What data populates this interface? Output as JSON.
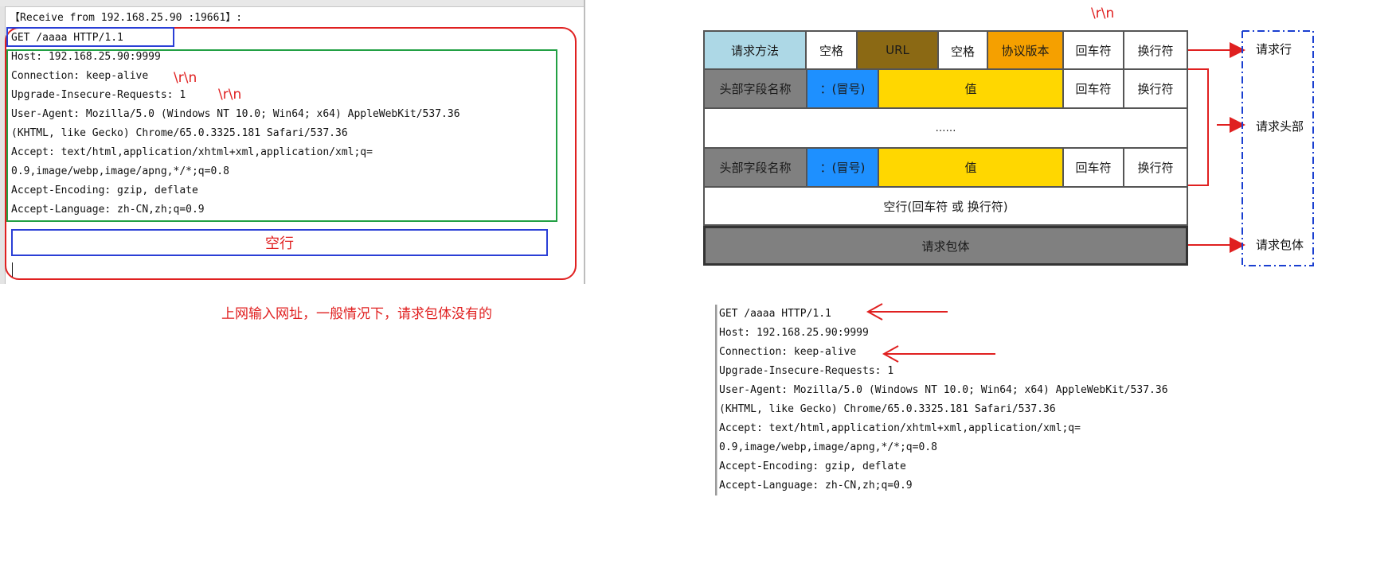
{
  "left_panel": {
    "receive_line": "【Receive from 192.168.25.90 :19661】:",
    "lines": [
      "GET /aaaa HTTP/1.1",
      "Host: 192.168.25.90:9999",
      "Connection: keep-alive",
      "Upgrade-Insecure-Requests: 1",
      "User-Agent: Mozilla/5.0 (Windows NT 10.0; Win64; x64) AppleWebKit/537.36",
      "(KHTML, like Gecko) Chrome/65.0.3325.181 Safari/537.36",
      "Accept: text/html,application/xhtml+xml,application/xml;q=",
      "0.9,image/webp,image/apng,*/*;q=0.8",
      "Accept-Encoding: gzip, deflate",
      "Accept-Language: zh-CN,zh;q=0.9"
    ],
    "crlf_1": "\\r\\n",
    "crlf_2": "\\r\\n",
    "empty_line_label": "空行"
  },
  "caption": "上网输入网址，一般情况下，请求包体没有的",
  "diagram": {
    "top_crlf": "\\r\\n",
    "request_line": [
      "请求方法",
      "空格",
      "URL",
      "空格",
      "协议版本",
      "回车符",
      "换行符"
    ],
    "header_row": [
      "头部字段名称",
      "：(冒号)",
      "值",
      "回车符",
      "换行符"
    ],
    "ellipsis": "……",
    "empty_line": "空行(回车符 或 换行符)",
    "body": "请求包体",
    "side_labels": {
      "request_line": "请求行",
      "request_headers": "请求头部",
      "request_body": "请求包体"
    },
    "colors": {
      "method": "#add8e6",
      "url": "#8b6914",
      "version": "#f5a000",
      "header_name": "#808080",
      "colon": "#1e90ff",
      "value": "#ffd700",
      "body": "#808080",
      "arrow": "#e02020",
      "bracket": "#1a3fd0"
    }
  },
  "right_text": {
    "lines": [
      "GET /aaaa HTTP/1.1",
      "Host: 192.168.25.90:9999",
      "Connection: keep-alive",
      "Upgrade-Insecure-Requests: 1",
      "User-Agent: Mozilla/5.0 (Windows NT 10.0; Win64; x64) AppleWebKit/537.36",
      "(KHTML, like Gecko) Chrome/65.0.3325.181 Safari/537.36",
      "Accept: text/html,application/xhtml+xml,application/xml;q=",
      "0.9,image/webp,image/apng,*/*;q=0.8",
      "Accept-Encoding: gzip, deflate",
      "Accept-Language: zh-CN,zh;q=0.9"
    ]
  }
}
